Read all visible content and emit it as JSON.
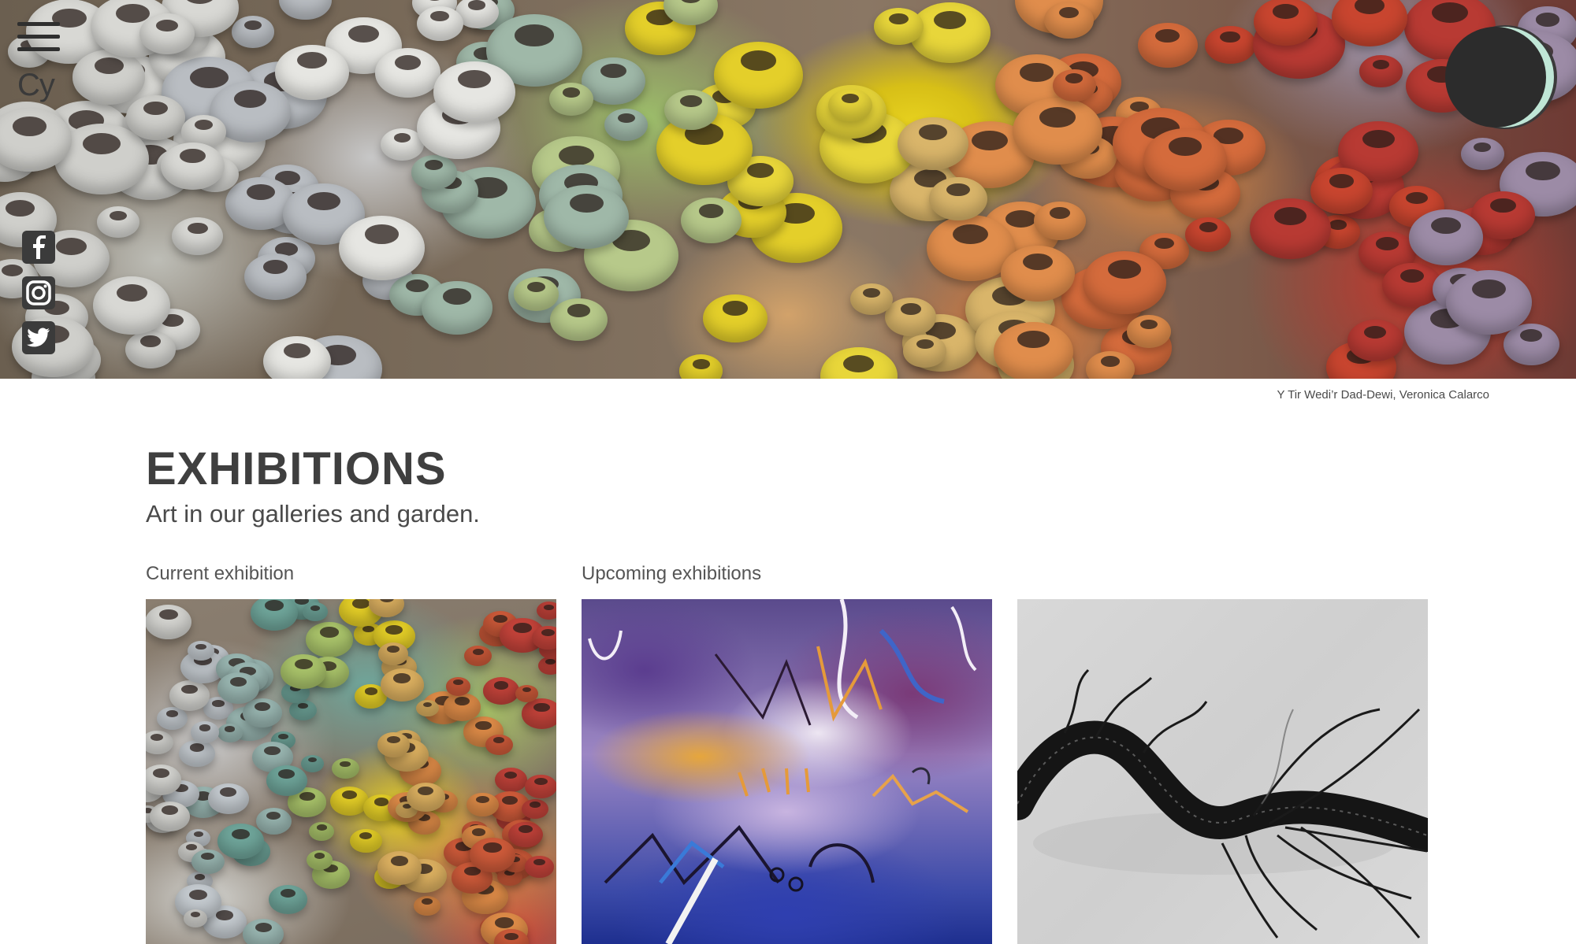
{
  "header": {
    "language_toggle": "Cy",
    "hero_caption": "Y Tir Wedi’r Dad-Dewi, Veronica Calarco",
    "social_icons": [
      "facebook-icon",
      "instagram-icon",
      "twitter-icon"
    ]
  },
  "main": {
    "title": "EXHIBITIONS",
    "subtitle": "Art in our galleries and garden.",
    "current_label": "Current exhibition",
    "upcoming_label": "Upcoming exhibitions"
  },
  "colors": {
    "text": "#3f3f3f",
    "icon": "#3b3b3b",
    "logo_accent": "#bfe6d6"
  }
}
